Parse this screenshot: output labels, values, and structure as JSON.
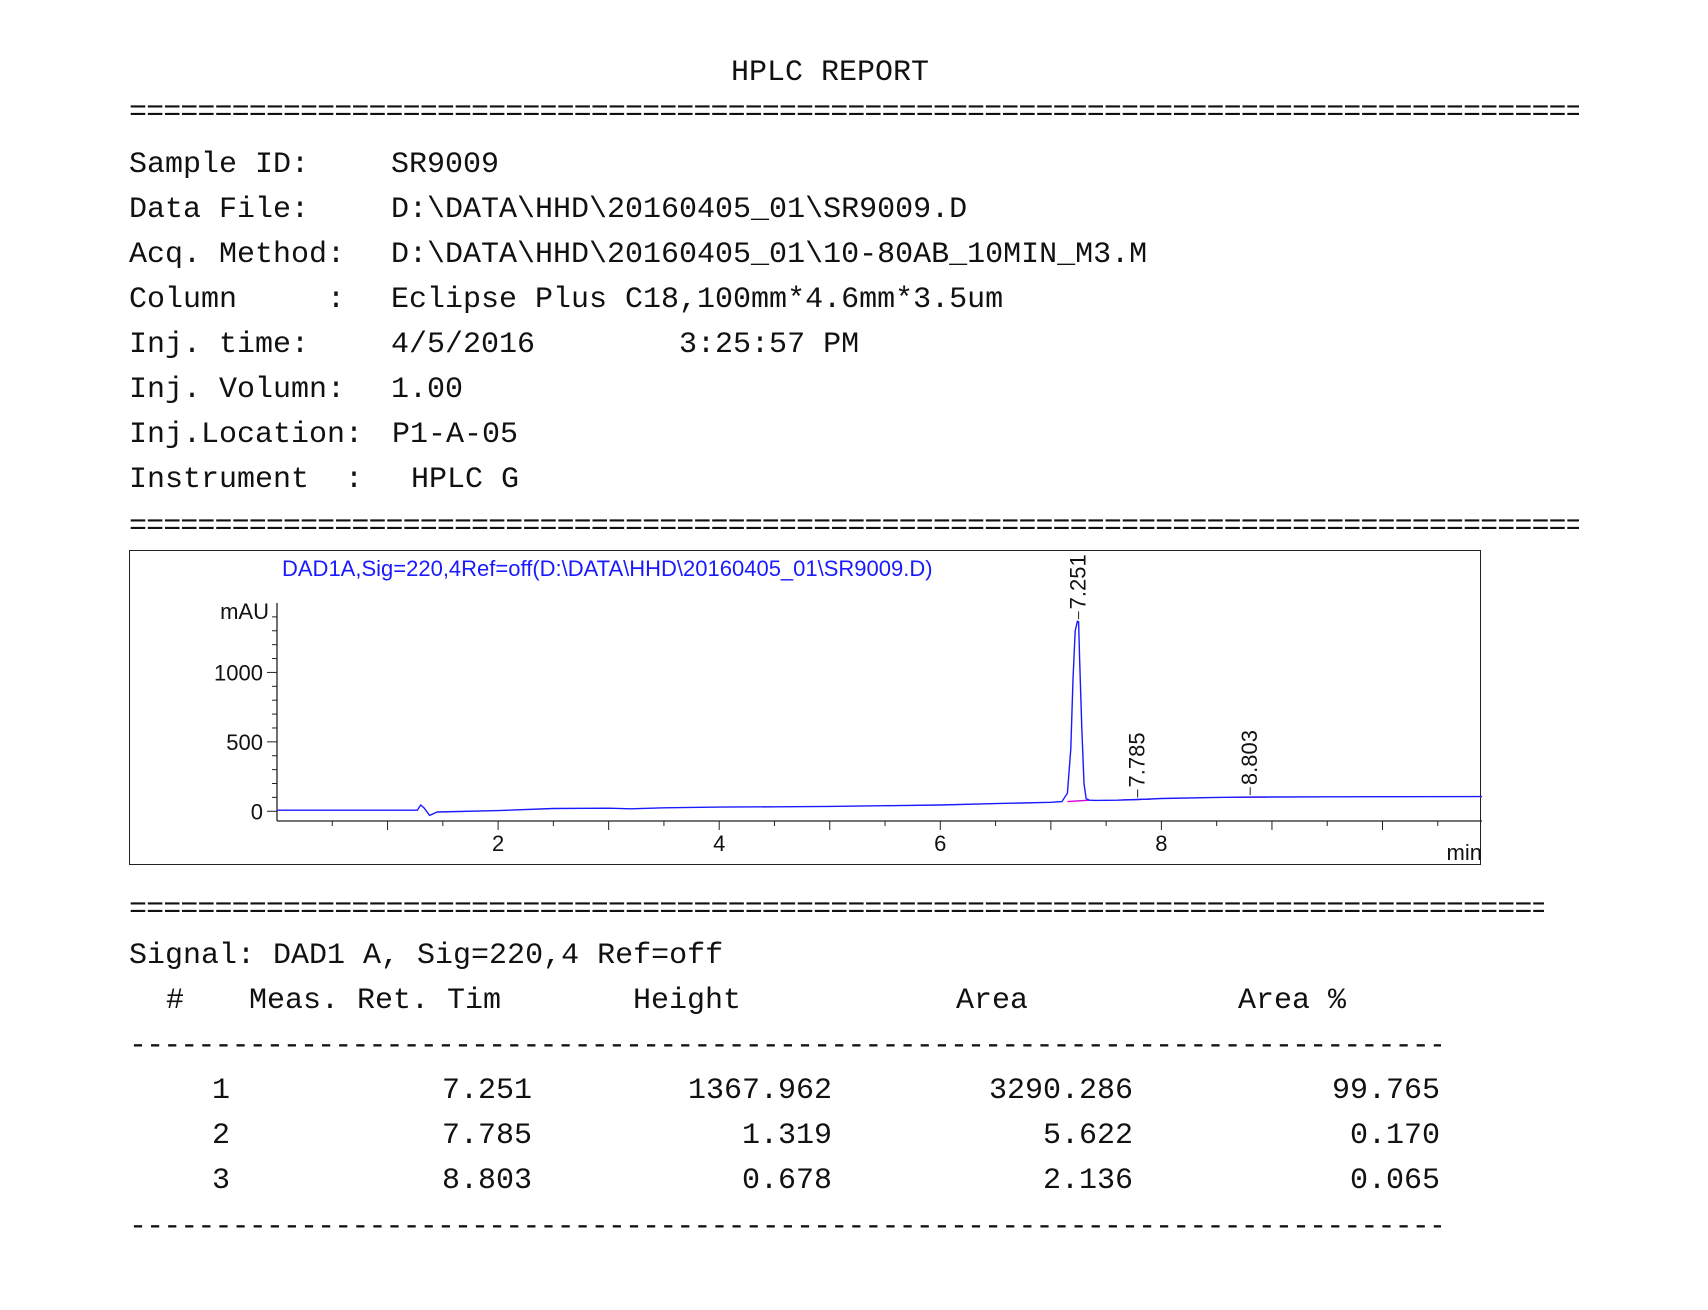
{
  "report_title": "HPLC REPORT",
  "info": [
    {
      "label": "Sample ID:",
      "value": "SR9009"
    },
    {
      "label": "Data File:",
      "value": "D:\\DATA\\HHD\\20160405_01\\SR9009.D"
    },
    {
      "label": "Acq. Method:",
      "value": "D:\\DATA\\HHD\\20160405_01\\10-80AB_10MIN_M3.M"
    },
    {
      "label": "Column     :",
      "value": "Eclipse Plus C18,100mm*4.6mm*3.5um"
    },
    {
      "label": "Inj. time:",
      "value": "4/5/2016        3:25:57 PM"
    },
    {
      "label": "Inj. Volumn:",
      "value": "1.00"
    },
    {
      "label": "Inj.Location:",
      "value": "P1-A-05"
    },
    {
      "label": "Instrument  :",
      "value": "HPLC G"
    }
  ],
  "chart_data": {
    "type": "line",
    "title": "DAD1A,Sig=220,4Ref=off(D:\\DATA\\HHD\\20160405_01\\SR9009.D)",
    "xlabel": "min",
    "ylabel": "mAU",
    "xlim": [
      0,
      10.9
    ],
    "ylim": [
      -70,
      1500
    ],
    "x_ticks": [
      2,
      4,
      6,
      8
    ],
    "y_ticks": [
      0,
      500,
      1000
    ],
    "grid": false,
    "series": [
      {
        "x": [
          0,
          1.2,
          1.27,
          1.3,
          1.33,
          1.38,
          1.45,
          2.0,
          2.5,
          3.0,
          3.2,
          3.5,
          4.0,
          4.5,
          5.0,
          5.5,
          6.0,
          6.5,
          7.0,
          7.1,
          7.15,
          7.18,
          7.2,
          7.22,
          7.24,
          7.251,
          7.26,
          7.28,
          7.3,
          7.32,
          7.35,
          7.4,
          7.6,
          7.785,
          8.0,
          8.5,
          8.803,
          9.0,
          9.5,
          10.0,
          10.9
        ],
        "y": [
          8,
          8,
          8,
          45,
          25,
          -30,
          -5,
          5,
          20,
          22,
          18,
          25,
          30,
          32,
          35,
          40,
          45,
          55,
          65,
          70,
          130,
          450,
          950,
          1300,
          1368,
          1365,
          1100,
          600,
          200,
          90,
          80,
          78,
          80,
          85,
          92,
          100,
          102,
          103,
          104,
          105,
          106
        ]
      }
    ],
    "peaks": [
      {
        "rt": "7.251",
        "x": 7.251,
        "height": 1368
      },
      {
        "rt": "7.785",
        "x": 7.785,
        "height": 85
      },
      {
        "rt": "8.803",
        "x": 8.803,
        "height": 102
      }
    ],
    "line_color": "#1a1aff",
    "baseline_color": "#d600d6"
  },
  "signal_line": "Signal: DAD1 A, Sig=220,4 Ref=off",
  "table": {
    "headers": [
      "#",
      "Meas. Ret. Tim",
      "Height",
      "Area",
      "Area %"
    ],
    "rows": [
      [
        "1",
        "7.251",
        "1367.962",
        "3290.286",
        "99.765"
      ],
      [
        "2",
        "7.785",
        "1.319",
        "5.622",
        "0.170"
      ],
      [
        "3",
        "8.803",
        "0.678",
        "2.136",
        "0.065"
      ]
    ]
  }
}
